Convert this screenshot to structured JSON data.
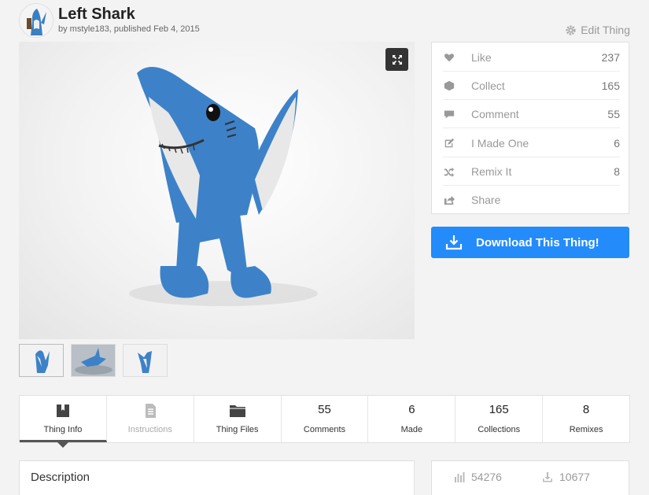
{
  "thing": {
    "title": "Left Shark",
    "byline": "by mstyle183, published Feb 4, 2015",
    "edit_label": "Edit Thing"
  },
  "actions": [
    {
      "label": "Like",
      "count": "237",
      "icon": "heart-icon"
    },
    {
      "label": "Collect",
      "count": "165",
      "icon": "collect-icon"
    },
    {
      "label": "Comment",
      "count": "55",
      "icon": "comment-icon"
    },
    {
      "label": "I Made One",
      "count": "6",
      "icon": "made-icon"
    },
    {
      "label": "Remix It",
      "count": "8",
      "icon": "remix-icon"
    },
    {
      "label": "Share",
      "count": "",
      "icon": "share-icon"
    }
  ],
  "download": {
    "label": "Download This Thing!"
  },
  "tabs": [
    {
      "label": "Thing Info",
      "value": "",
      "icon": "book-icon",
      "active": true
    },
    {
      "label": "Instructions",
      "value": "",
      "icon": "document-icon",
      "disabled": true
    },
    {
      "label": "Thing Files",
      "value": "",
      "icon": "folder-icon"
    },
    {
      "label": "Comments",
      "value": "55"
    },
    {
      "label": "Made",
      "value": "6"
    },
    {
      "label": "Collections",
      "value": "165"
    },
    {
      "label": "Remixes",
      "value": "8"
    }
  ],
  "description": {
    "title": "Description"
  },
  "stats": {
    "views": "54276",
    "downloads": "10677"
  },
  "colors": {
    "accent": "#248bfb",
    "background": "#f3f3f3"
  }
}
